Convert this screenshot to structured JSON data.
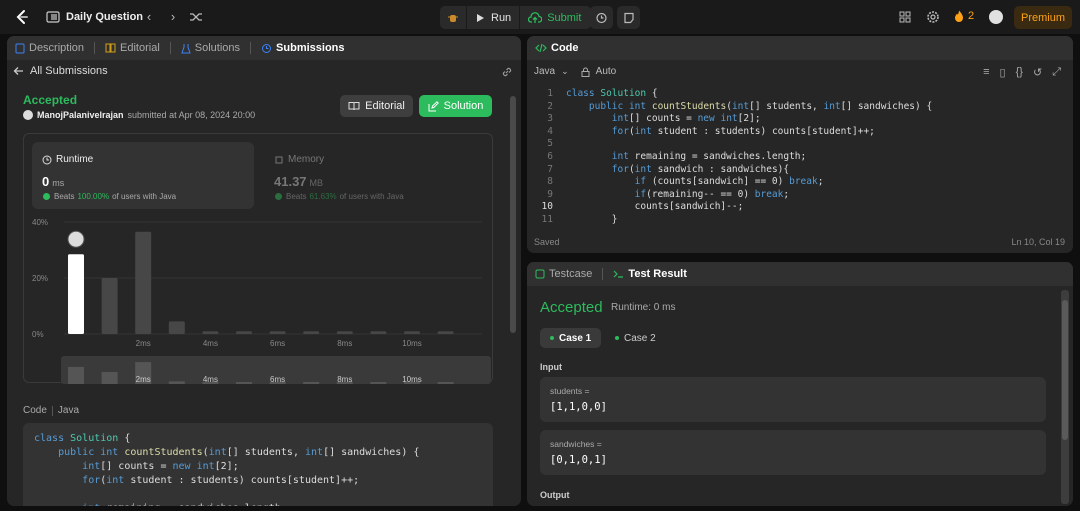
{
  "topbar": {
    "title": "Daily Question",
    "run_label": "Run",
    "submit_label": "Submit",
    "streak_count": "2",
    "premium_label": "Premium"
  },
  "left_tabs": [
    {
      "label": "Description"
    },
    {
      "label": "Editorial"
    },
    {
      "label": "Solutions"
    },
    {
      "label": "Submissions"
    }
  ],
  "submission": {
    "back_label": "All Submissions",
    "status": "Accepted",
    "user": "ManojPalanivelrajan",
    "submitted_text": "submitted at Apr 08, 2024 20:00",
    "editorial_label": "Editorial",
    "solution_label": "Solution"
  },
  "runtime": {
    "label": "Runtime",
    "value": "0",
    "unit": "ms",
    "beats_prefix": "Beats",
    "beats_pct": "100.00%",
    "beats_suffix": "of users with Java"
  },
  "memory": {
    "label": "Memory",
    "value": "41.37",
    "unit": "MB",
    "beats_prefix": "Beats",
    "beats_pct": "61.63%",
    "beats_suffix": "of users with Java"
  },
  "chart_data": {
    "type": "bar",
    "title": "",
    "xlabel": "",
    "ylabel": "",
    "y_ticks": [
      "40%",
      "20%",
      "0%"
    ],
    "ylim": [
      0,
      40
    ],
    "grid": true,
    "categories": [
      "0ms",
      "1ms",
      "2ms",
      "3ms",
      "4ms",
      "5ms",
      "6ms",
      "7ms",
      "8ms",
      "9ms",
      "10ms",
      "11ms"
    ],
    "x_tick_labels": [
      "2ms",
      "4ms",
      "6ms",
      "8ms",
      "10ms"
    ],
    "values": [
      28.5,
      20,
      36.5,
      4.5,
      1,
      1,
      1,
      1,
      1,
      1,
      1,
      1
    ],
    "highlight_index": 0,
    "colors": {
      "highlight": "#ffffff",
      "bar": "#474747",
      "grid": "#3a3a3a"
    }
  },
  "code_section": {
    "label": "Code",
    "lang": "Java",
    "lines": [
      "class Solution {",
      "    public int countStudents(int[] students, int[] sandwiches) {",
      "        int[] counts = new int[2];",
      "        for(int student : students) counts[student]++;",
      "",
      "        int remaining = sandwiches.length;"
    ]
  },
  "code_panel": {
    "title": "Code",
    "language": "Java",
    "mode": "Auto",
    "current_line": 10,
    "lines": [
      {
        "n": "1",
        "t": "class Solution {"
      },
      {
        "n": "2",
        "t": "    public int countStudents(int[] students, int[] sandwiches) {"
      },
      {
        "n": "3",
        "t": "        int[] counts = new int[2];"
      },
      {
        "n": "4",
        "t": "        for(int student : students) counts[student]++;"
      },
      {
        "n": "5",
        "t": ""
      },
      {
        "n": "6",
        "t": "        int remaining = sandwiches.length;"
      },
      {
        "n": "7",
        "t": "        for(int sandwich : sandwiches){"
      },
      {
        "n": "8",
        "t": "            if (counts[sandwich] == 0) break;"
      },
      {
        "n": "9",
        "t": "            if(remaining-- == 0) break;"
      },
      {
        "n": "10",
        "t": "            counts[sandwich]--;"
      },
      {
        "n": "11",
        "t": "        }"
      }
    ],
    "saved": "Saved",
    "position": "Ln 10, Col 19"
  },
  "result_panel": {
    "tab_testcase": "Testcase",
    "tab_result": "Test Result",
    "status": "Accepted",
    "runtime": "Runtime: 0 ms",
    "cases": [
      "Case 1",
      "Case 2"
    ],
    "input_label": "Input",
    "inputs": [
      {
        "name": "students =",
        "value": "[1,1,0,0]"
      },
      {
        "name": "sandwiches =",
        "value": "[0,1,0,1]"
      }
    ],
    "output_label": "Output"
  }
}
